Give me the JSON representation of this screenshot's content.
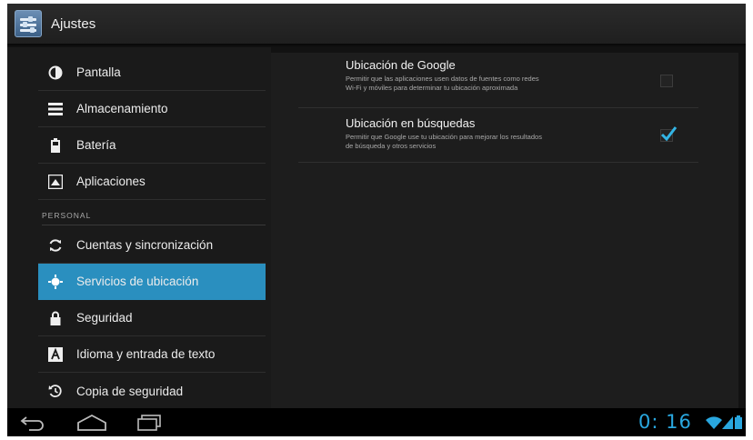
{
  "action_bar": {
    "title": "Ajustes",
    "icon": "settings-icon"
  },
  "sidebar": {
    "items": [
      {
        "label": "Pantalla",
        "icon": "brightness-icon"
      },
      {
        "label": "Almacenamiento",
        "icon": "storage-icon"
      },
      {
        "label": "Batería",
        "icon": "battery-icon"
      },
      {
        "label": "Aplicaciones",
        "icon": "apps-icon"
      }
    ],
    "section_header": "PERSONAL",
    "personal_items": [
      {
        "label": "Cuentas y sincronización",
        "icon": "sync-icon"
      },
      {
        "label": "Servicios de ubicación",
        "icon": "location-icon",
        "selected": true
      },
      {
        "label": "Seguridad",
        "icon": "lock-icon"
      },
      {
        "label": "Idioma y entrada de texto",
        "icon": "language-icon"
      },
      {
        "label": "Copia de seguridad",
        "icon": "backup-icon"
      }
    ]
  },
  "preferences": [
    {
      "title": "Ubicación de Google",
      "summary_line1": "Permitir que las aplicaciones usen datos de fuentes como redes",
      "summary_line2": "Wi-Fi y móviles para determinar tu ubicación aproximada",
      "checked": false
    },
    {
      "title": "Ubicación en búsquedas",
      "summary_line1": "Permitir que Google use tu ubicación para mejorar los resultados",
      "summary_line2": "de búsqueda y otros servicios",
      "checked": true
    }
  ],
  "nav_bar": {
    "clock": "0: 16",
    "accent": "#29a7df",
    "icons": [
      "back-icon",
      "home-icon",
      "recent-apps-icon",
      "wifi-icon",
      "signal-icon",
      "battery-status-icon"
    ]
  },
  "colors": {
    "selected": "#2a8fbf",
    "checkmark": "#33b5e5"
  }
}
